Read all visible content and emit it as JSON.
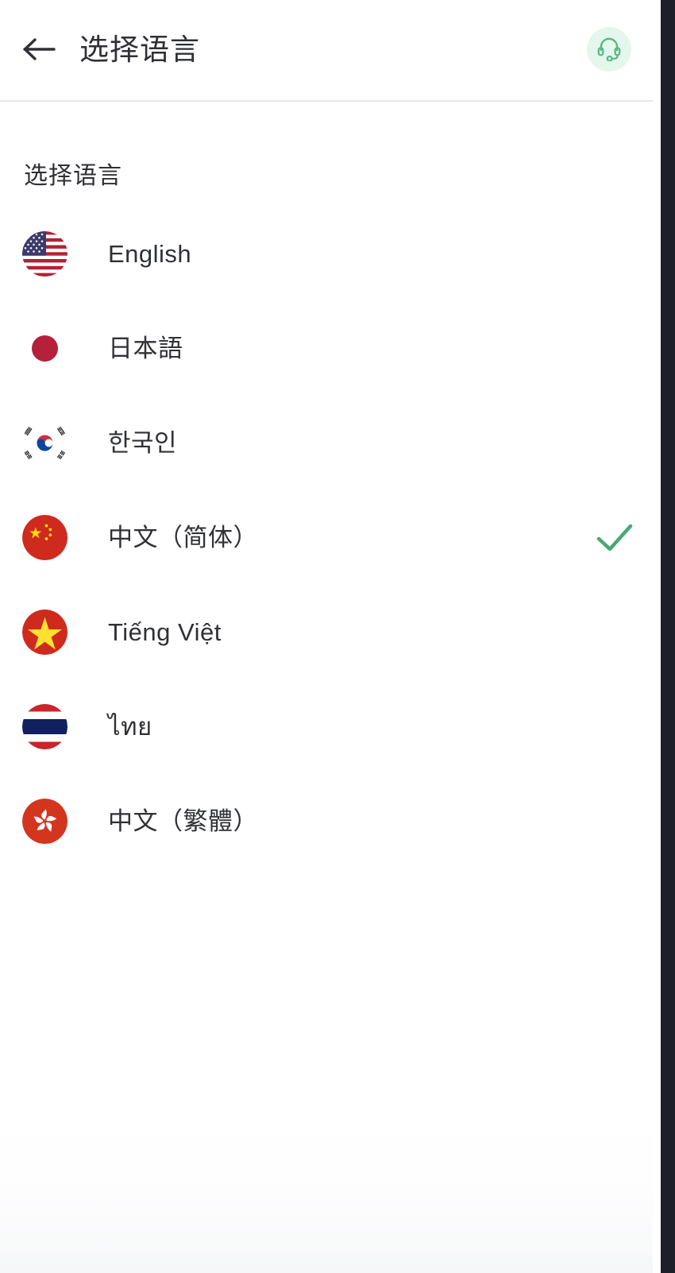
{
  "header": {
    "title": "选择语言",
    "back_icon": "arrow-left-icon",
    "support_icon": "headset-icon",
    "support_bg": "#e4f7ec",
    "support_fg": "#57b688"
  },
  "section": {
    "title": "选择语言"
  },
  "languages": [
    {
      "label": "English",
      "flag": "flag-us",
      "selected": false
    },
    {
      "label": "日本語",
      "flag": "flag-jp",
      "selected": false
    },
    {
      "label": "한국인",
      "flag": "flag-kr",
      "selected": false
    },
    {
      "label": "中文（简体）",
      "flag": "flag-cn",
      "selected": true
    },
    {
      "label": "Tiếng Việt",
      "flag": "flag-vn",
      "selected": false
    },
    {
      "label": "ไทย",
      "flag": "flag-th",
      "selected": false
    },
    {
      "label": "中文（繁體）",
      "flag": "flag-hk",
      "selected": false
    }
  ],
  "check_icon": "check-icon",
  "colors": {
    "accent_green": "#4aa873",
    "text_primary": "#2f3134",
    "divider": "#e5e7e9",
    "edge_strip": "#1d2026",
    "flag_red": "#c1272d",
    "us_navy": "#3c3b6e",
    "us_red": "#b22234",
    "jp_red": "#b5203a",
    "cn_red": "#cf2a1e",
    "cn_yellow": "#ffde00",
    "vn_red": "#cf2a1e",
    "vn_yellow": "#ffe032",
    "th_red": "#c8262a",
    "th_blue": "#12205f",
    "kr_red": "#cd2e3a",
    "kr_blue": "#0047a0",
    "hk_red": "#d4351f"
  }
}
